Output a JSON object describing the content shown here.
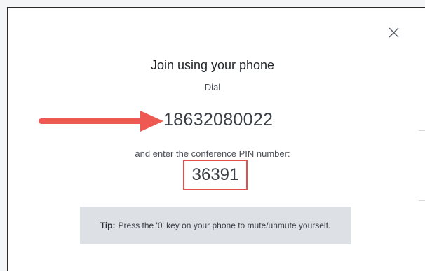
{
  "dialog": {
    "title": "Join using your phone",
    "dial_label": "Dial",
    "phone_number": "18632080022",
    "pin_instruction": "and enter the conference PIN number:",
    "pin": "36391",
    "tip_label": "Tip:",
    "tip_text": "Press the '0' key on your phone to mute/unmute yourself.",
    "close_icon": "close-icon"
  },
  "annotations": {
    "arrow_color": "#ee5a52",
    "highlight_color": "#e0514b"
  }
}
